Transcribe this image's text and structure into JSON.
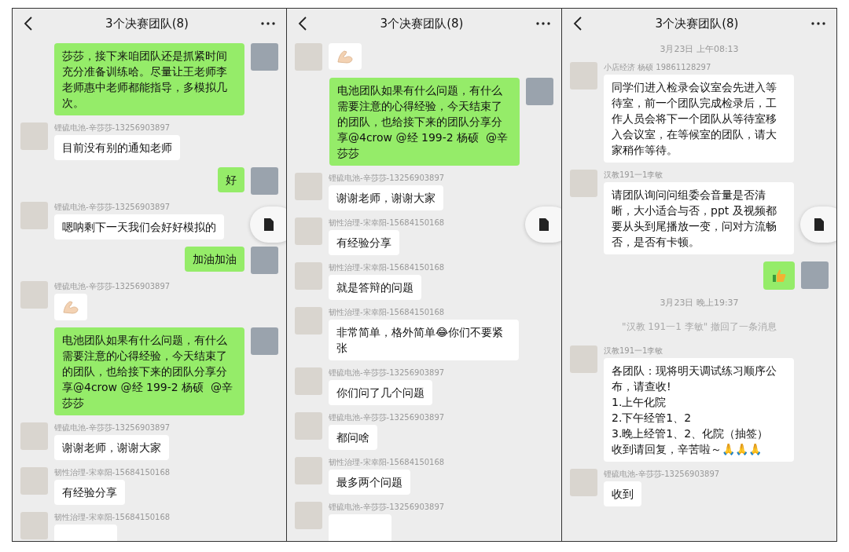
{
  "panels": [
    {
      "title": "3个决赛团队(8)",
      "messages": [
        {
          "kind": "out",
          "text": "莎莎，接下来咱团队还是抓紧时间充分准备训练哈。尽量让王老师李老师惠中老师都能指导，多模拟几次。"
        },
        {
          "kind": "in",
          "sender": "锂硫电池-辛莎莎-13256903897",
          "text": "目前没有别的通知老师"
        },
        {
          "kind": "out",
          "text": "好"
        },
        {
          "kind": "in",
          "sender": "锂硫电池-辛莎莎-13256903897",
          "text": "嗯呐剩下一天我们会好好模拟的"
        },
        {
          "kind": "out",
          "text": "加油加油"
        },
        {
          "kind": "flex",
          "sender": "锂硫电池-辛莎莎-13256903897"
        },
        {
          "kind": "out",
          "text": "电池团队如果有什么问题，有什么需要注意的心得经验，今天结束了的团队，也给接下来的团队分享分享@4crow @经 199-2 杨硕  @辛莎莎"
        },
        {
          "kind": "in",
          "sender": "锂硫电池-辛莎莎-13256903897",
          "text": "谢谢老师，谢谢大家"
        },
        {
          "kind": "in",
          "sender": "韧性治理-宋幸阳-15684150168",
          "text": "有经验分享"
        },
        {
          "kind": "in",
          "sender": "韧性治理-宋幸阳-15684150168"
        }
      ]
    },
    {
      "title": "3个决赛团队(8)",
      "messages": [
        {
          "kind": "flex"
        },
        {
          "kind": "out",
          "text": "电池团队如果有什么问题，有什么需要注意的心得经验，今天结束了的团队，也给接下来的团队分享分享@4crow @经 199-2 杨硕  @辛莎莎"
        },
        {
          "kind": "in",
          "sender": "锂硫电池-辛莎莎-13256903897",
          "text": "谢谢老师，谢谢大家"
        },
        {
          "kind": "in",
          "sender": "韧性治理-宋幸阳-15684150168",
          "text": "有经验分享"
        },
        {
          "kind": "in",
          "sender": "韧性治理-宋幸阳-15684150168",
          "text": "就是答辩的问题"
        },
        {
          "kind": "in",
          "sender": "韧性治理-宋幸阳-15684150168",
          "text": "非常简单，格外简单😂你们不要紧张"
        },
        {
          "kind": "in",
          "sender": "锂硫电池-辛莎莎-13256903897",
          "text": "你们问了几个问题"
        },
        {
          "kind": "in",
          "sender": "锂硫电池-辛莎莎-13256903897",
          "text": "都问啥"
        },
        {
          "kind": "in",
          "sender": "韧性治理-宋幸阳-15684150168",
          "text": "最多两个问题"
        },
        {
          "kind": "in",
          "sender": "锂硫电池-辛莎莎-13256903897"
        }
      ]
    },
    {
      "title": "3个决赛团队(8)",
      "messages": [
        {
          "kind": "time",
          "text": "3月23日 上午08:13"
        },
        {
          "kind": "in",
          "sender": "小店经济 杨硕 19861128297",
          "text": "同学们进入检录会议室会先进入等待室，前一个团队完成检录后，工作人员会将下一个团队从等待室移入会议室，在等候室的团队，请大家稍作等待。"
        },
        {
          "kind": "in",
          "sender": "汉教191一1李敏",
          "text": "请团队询问问组委会音量是否清晰，大小适合与否，ppt 及视频都要从头到尾播放一变，问对方流畅否，是否有卡顿。"
        },
        {
          "kind": "thumb"
        },
        {
          "kind": "time",
          "text": "3月23日 晚上19:37"
        },
        {
          "kind": "notice",
          "text": "\"汉教 191一1 李敏\" 撤回了一条消息"
        },
        {
          "kind": "in",
          "sender": "汉教191一1李敏",
          "lines": [
            "各团队：现将明天调试练习顺序公布，请查收!",
            "1.上午化院",
            "2.下午经管1、2",
            "3.晚上经管1、2、化院（抽签）",
            "收到请回复，辛苦啦～🙏🙏🙏"
          ]
        },
        {
          "kind": "in",
          "sender": "锂硫电池-辛莎莎-13256903897",
          "text": "收到"
        }
      ]
    }
  ]
}
